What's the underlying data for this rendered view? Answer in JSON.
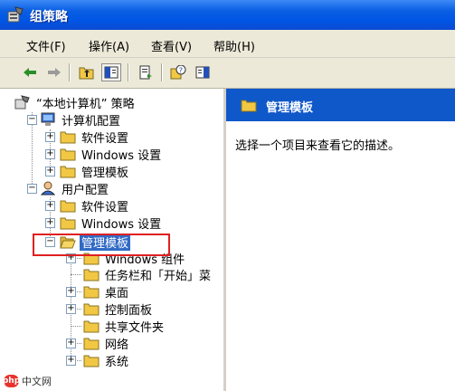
{
  "window": {
    "title": "组策略"
  },
  "menubar": {
    "items": [
      "文件(F)",
      "操作(A)",
      "查看(V)",
      "帮助(H)"
    ]
  },
  "toolbar": {
    "buttons": [
      "back-icon",
      "forward-icon",
      "up-folder-icon",
      "show-hide-tree-icon",
      "export-list-icon",
      "help-icon",
      "properties-icon"
    ]
  },
  "tree": {
    "root": "“本地计算机” 策略",
    "computer_config": "计算机配置",
    "cc_software": "软件设置",
    "cc_windows": "Windows 设置",
    "cc_admin": "管理模板",
    "user_config": "用户配置",
    "uc_software": "软件设置",
    "uc_windows": "Windows 设置",
    "uc_admin": "管理模板",
    "uc_admin_children": {
      "windows_components": "Windows 组件",
      "taskbar": "任务栏和「开始」菜",
      "desktop": "桌面",
      "control_panel": "控制面板",
      "shared_folders": "共享文件夹",
      "network": "网络",
      "system": "系统"
    }
  },
  "right_pane": {
    "header": "管理模板",
    "description": "选择一个项目来查看它的描述。"
  },
  "watermark": {
    "logo": "php",
    "text": "中文网"
  },
  "colors": {
    "titlebar": "#0055e5",
    "selection": "#316ac5",
    "highlight_box": "#e02020",
    "folder": "#f2c744"
  }
}
